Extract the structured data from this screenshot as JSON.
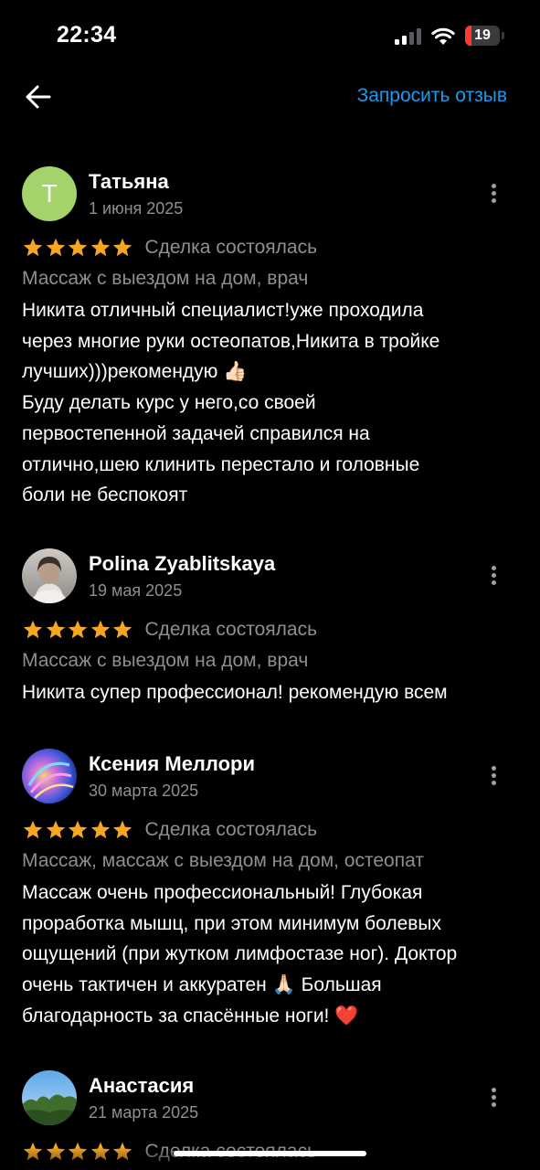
{
  "status_bar": {
    "time": "22:34",
    "battery_level": "19",
    "battery_fraction": 0.19,
    "battery_color": "#ff3b30",
    "signal_icon": "cellular-signal-icon",
    "wifi_icon": "wifi-icon"
  },
  "nav": {
    "back_icon": "arrow-left-icon",
    "request_review": "Запросить отзыв",
    "accent_color": "#1a9bf0"
  },
  "star_color": "#f5a623",
  "reviews": [
    {
      "author": "Татьяна",
      "avatar_letter": "Т",
      "avatar_color": "#a3d36a",
      "date": "1 июня 2025",
      "rating": 5,
      "deal_status": "Сделка состоялась",
      "category": "Массаж с выездом на дом, врач",
      "text": "Никита отличный специалист!уже проходила\nчерез многие руки остеопатов,Никита в тройке\nлучших)))рекомендую 👍🏻\nБуду делать курс у него,со своей\nпервостепенной задачей справился на\nотлично,шею клинить перестало и головные\nболи не беспокоят"
    },
    {
      "author": "Polina Zyablitskaya",
      "avatar_icon": "user-photo-avatar",
      "date": "19 мая 2025",
      "rating": 5,
      "deal_status": "Сделка состоялась",
      "category": "Массаж с выездом на дом, врач",
      "text": "Никита супер профессионал! рекомендую всем"
    },
    {
      "author": "Ксения Меллори",
      "avatar_icon": "abstract-art-avatar",
      "date": "30 марта 2025",
      "rating": 5,
      "deal_status": "Сделка состоялась",
      "category": "Массаж, массаж с выездом на дом, остеопат",
      "text": "Массаж очень профессиональный! Глубокая\nпроработка мышц, при этом минимум болевых\nощущений (при жутком лимфостазе ног). Доктор\nочень тактичен и аккуратен 🙏🏻 Большая\nблагодарность за спасённые ноги! ❤️"
    },
    {
      "author": "Анастасия",
      "avatar_icon": "landscape-avatar",
      "date": "21 марта 2025",
      "rating": 5,
      "deal_status": "Сделка состоялась"
    }
  ]
}
